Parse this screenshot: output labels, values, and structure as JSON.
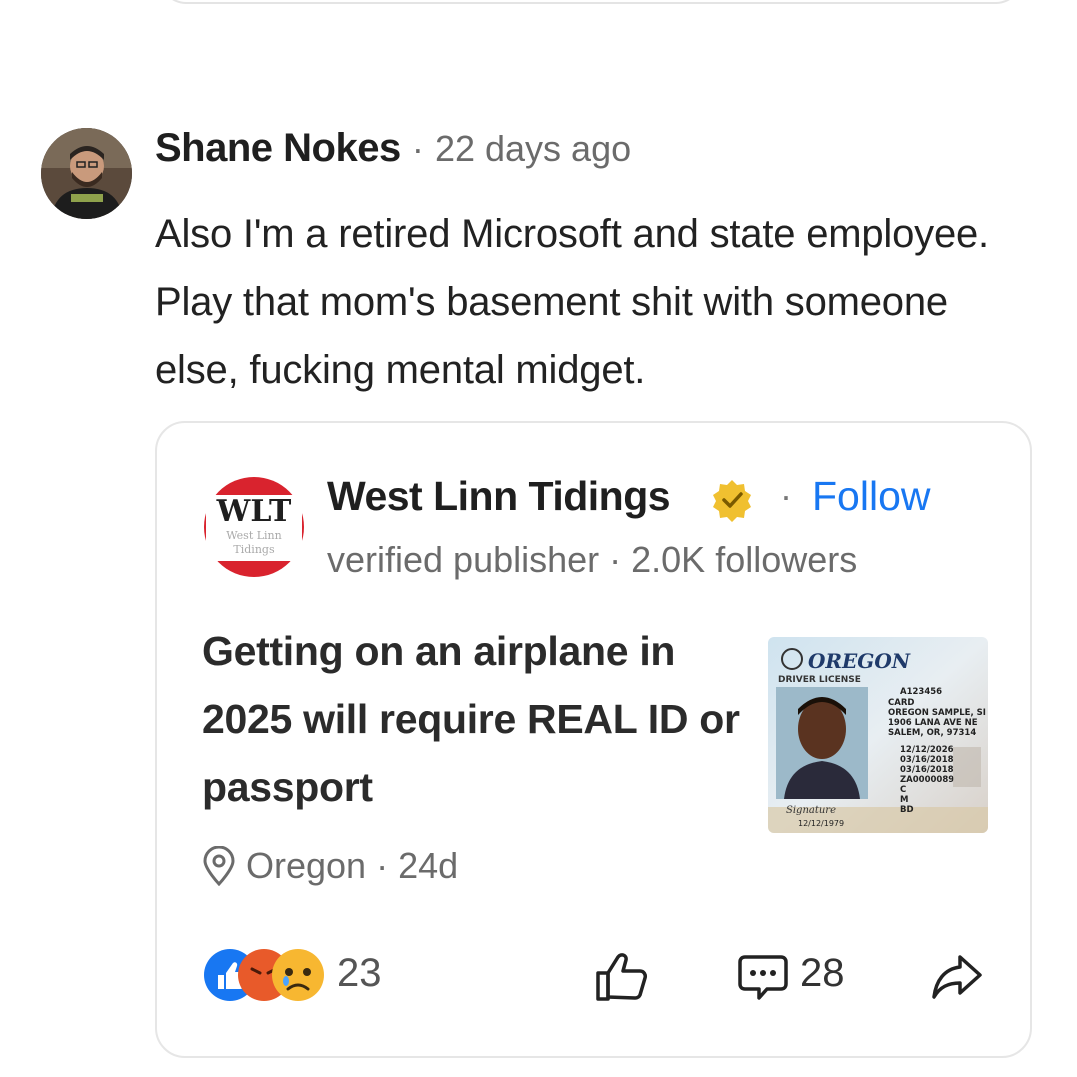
{
  "comment": {
    "author": "Shane Nokes",
    "separator": "·",
    "time": "22 days ago",
    "text": "Also I'm a retired Microsoft and state employee. Play that mom's basement shit with someone else, fucking mental midget."
  },
  "card": {
    "publisher": {
      "logo_text": "WLT",
      "logo_subtext": "West Linn Tidings",
      "name": "West Linn Tidings",
      "separator": "·",
      "follow_label": "Follow",
      "meta": "verified publisher · 2.0K followers"
    },
    "headline": "Getting on an airplane in 2025 will require REAL ID or passport",
    "thumbnail": {
      "state": "OREGON",
      "doc_type": "DRIVER LICENSE",
      "lines": [
        "A123456",
        "CARD",
        "OREGON SAMPLE, SI",
        "1906 LANA AVE NE",
        "SALEM, OR, 97314",
        "12/12/2026",
        "03/16/2018",
        "03/16/2018",
        "ZA0000089",
        "C",
        "M",
        "BD"
      ],
      "dob": "12/12/1979",
      "signature": "Signature"
    },
    "location": "Oregon · 24d",
    "reaction_count": "23",
    "comment_count": "28"
  },
  "colors": {
    "accent": "#1877f2",
    "badge": "#f0c030",
    "logo_red": "#d9232e"
  },
  "icons": [
    "location-pin-icon",
    "like-reaction-icon",
    "angry-reaction-icon",
    "sad-reaction-icon",
    "thumbs-up-icon",
    "comment-icon",
    "share-icon",
    "verified-badge-icon"
  ]
}
